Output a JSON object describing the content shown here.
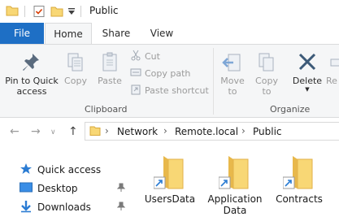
{
  "window": {
    "title": "Public"
  },
  "quick_access_toolbar": {
    "items": [
      "folder-icon",
      "properties-icon",
      "new-folder-icon",
      "customize-dropdown-icon"
    ]
  },
  "ribbon_tabs": {
    "file": "File",
    "home": "Home",
    "share": "Share",
    "view": "View",
    "active": "Home"
  },
  "ribbon": {
    "clipboard": {
      "group_label": "Clipboard",
      "pin_quick_access_line1": "Pin to Quick",
      "pin_quick_access_line2": "access",
      "copy": "Copy",
      "paste": "Paste",
      "cut": "Cut",
      "copy_path": "Copy path",
      "paste_shortcut": "Paste shortcut"
    },
    "organize": {
      "group_label": "Organize",
      "move_to_line1": "Move",
      "move_to_line2": "to",
      "copy_to_line1": "Copy",
      "copy_to_line2": "to",
      "delete": "Delete",
      "rename_partial": "Re"
    }
  },
  "address_bar": {
    "crumbs": [
      "Network",
      "Remote.local",
      "Public"
    ]
  },
  "nav_pane": {
    "items": [
      {
        "label": "Quick access",
        "icon": "star-icon",
        "pinned": false
      },
      {
        "label": "Desktop",
        "icon": "desktop-icon",
        "pinned": true
      },
      {
        "label": "Downloads",
        "icon": "download-icon",
        "pinned": true
      }
    ]
  },
  "files": [
    {
      "name_line1": "UsersData",
      "name_line2": "",
      "type": "shortcut-folder"
    },
    {
      "name_line1": "Application",
      "name_line2": "Data",
      "type": "shortcut-folder"
    },
    {
      "name_line1": "Contracts",
      "name_line2": "",
      "type": "shortcut-folder"
    }
  ],
  "colors": {
    "file_tab": "#1e6fc5",
    "ribbon_bg": "#f5f6f7",
    "folder_yellow": "#f8d775",
    "folder_dark": "#e8b84b",
    "disabled_text": "#9b9b9b",
    "accent_blue": "#2b7cd3"
  }
}
